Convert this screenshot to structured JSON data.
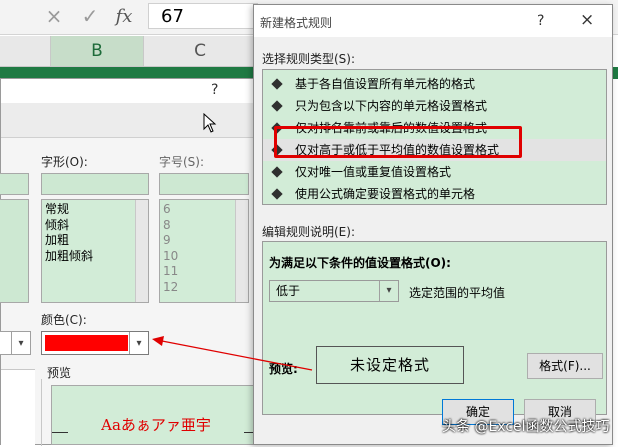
{
  "formula_bar": {
    "cancel_icon": "×",
    "enter_icon": "✓",
    "fx_icon": "fx",
    "value": "67"
  },
  "columns": {
    "b": "B",
    "c": "C"
  },
  "format_cells_dialog": {
    "help": "?",
    "close": "×",
    "font_style_label": "字形(O):",
    "size_label": "字号(S):",
    "font_styles": [
      "常规",
      "倾斜",
      "加粗",
      "加粗倾斜"
    ],
    "sizes": [
      "6",
      "8",
      "9",
      "10",
      "11",
      "12"
    ],
    "color_label": "颜色(C):",
    "color_value": "#ff0000",
    "preview_label": "预览",
    "preview_text": "Aaあぁアァ亜宇"
  },
  "new_rule_dialog": {
    "title": "新建格式规则",
    "help": "?",
    "close": "×",
    "select_rule_type_label": "选择规则类型(S):",
    "rule_types": [
      "基于各自值设置所有单元格的格式",
      "只为包含以下内容的单元格设置格式",
      "仅对排名靠前或靠后的数值设置格式",
      "仅对高于或低于平均值的数值设置格式",
      "仅对唯一值或重复值设置格式",
      "使用公式确定要设置格式的单元格"
    ],
    "selected_index": 3,
    "edit_desc_label": "编辑规则说明(E):",
    "format_values_label": "为满足以下条件的值设置格式(O):",
    "condition_value": "低于",
    "range_label": "选定范围的平均值",
    "preview_label": "预览:",
    "preview_text": "未设定格式",
    "format_button": "格式(F)...",
    "ok_button": "确定",
    "cancel_button": "取消"
  },
  "watermark": "头条 @Excel函数公式技巧",
  "colors": {
    "highlight_red": "#e00000",
    "list_green": "#d2ecd7",
    "excel_green": "#1f7a43"
  }
}
